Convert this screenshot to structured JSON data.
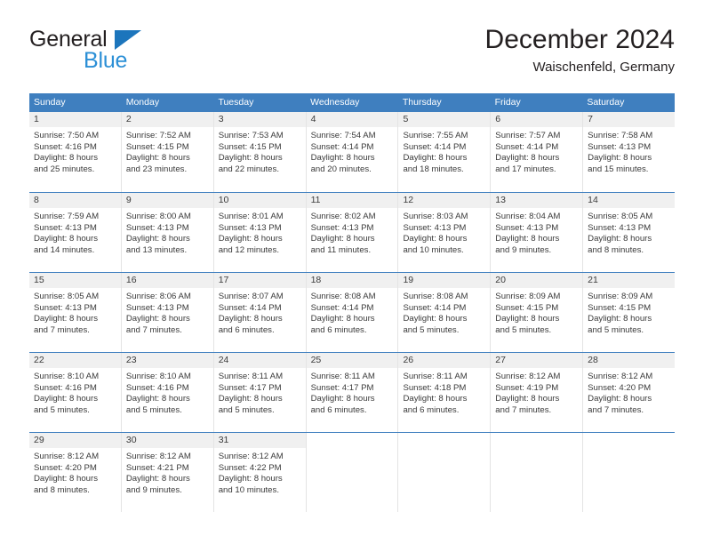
{
  "brand": {
    "name_top": "General",
    "name_bottom": "Blue",
    "triangle_color": "#1c75bc",
    "blue_text_color": "#2b8fd6"
  },
  "header": {
    "title": "December 2024",
    "subtitle": "Waischenfeld, Germany"
  },
  "theme": {
    "header_row_bg": "#3f7fbf",
    "header_row_text": "#ffffff",
    "day_number_bg": "#f0f0f0",
    "row_separator": "#3f7fbf",
    "cell_divider": "#e4e4e4",
    "body_text": "#3a3a3a"
  },
  "weekdays": [
    "Sunday",
    "Monday",
    "Tuesday",
    "Wednesday",
    "Thursday",
    "Friday",
    "Saturday"
  ],
  "weeks": [
    [
      {
        "day": "1",
        "sunrise": "Sunrise: 7:50 AM",
        "sunset": "Sunset: 4:16 PM",
        "daylight1": "Daylight: 8 hours",
        "daylight2": "and 25 minutes."
      },
      {
        "day": "2",
        "sunrise": "Sunrise: 7:52 AM",
        "sunset": "Sunset: 4:15 PM",
        "daylight1": "Daylight: 8 hours",
        "daylight2": "and 23 minutes."
      },
      {
        "day": "3",
        "sunrise": "Sunrise: 7:53 AM",
        "sunset": "Sunset: 4:15 PM",
        "daylight1": "Daylight: 8 hours",
        "daylight2": "and 22 minutes."
      },
      {
        "day": "4",
        "sunrise": "Sunrise: 7:54 AM",
        "sunset": "Sunset: 4:14 PM",
        "daylight1": "Daylight: 8 hours",
        "daylight2": "and 20 minutes."
      },
      {
        "day": "5",
        "sunrise": "Sunrise: 7:55 AM",
        "sunset": "Sunset: 4:14 PM",
        "daylight1": "Daylight: 8 hours",
        "daylight2": "and 18 minutes."
      },
      {
        "day": "6",
        "sunrise": "Sunrise: 7:57 AM",
        "sunset": "Sunset: 4:14 PM",
        "daylight1": "Daylight: 8 hours",
        "daylight2": "and 17 minutes."
      },
      {
        "day": "7",
        "sunrise": "Sunrise: 7:58 AM",
        "sunset": "Sunset: 4:13 PM",
        "daylight1": "Daylight: 8 hours",
        "daylight2": "and 15 minutes."
      }
    ],
    [
      {
        "day": "8",
        "sunrise": "Sunrise: 7:59 AM",
        "sunset": "Sunset: 4:13 PM",
        "daylight1": "Daylight: 8 hours",
        "daylight2": "and 14 minutes."
      },
      {
        "day": "9",
        "sunrise": "Sunrise: 8:00 AM",
        "sunset": "Sunset: 4:13 PM",
        "daylight1": "Daylight: 8 hours",
        "daylight2": "and 13 minutes."
      },
      {
        "day": "10",
        "sunrise": "Sunrise: 8:01 AM",
        "sunset": "Sunset: 4:13 PM",
        "daylight1": "Daylight: 8 hours",
        "daylight2": "and 12 minutes."
      },
      {
        "day": "11",
        "sunrise": "Sunrise: 8:02 AM",
        "sunset": "Sunset: 4:13 PM",
        "daylight1": "Daylight: 8 hours",
        "daylight2": "and 11 minutes."
      },
      {
        "day": "12",
        "sunrise": "Sunrise: 8:03 AM",
        "sunset": "Sunset: 4:13 PM",
        "daylight1": "Daylight: 8 hours",
        "daylight2": "and 10 minutes."
      },
      {
        "day": "13",
        "sunrise": "Sunrise: 8:04 AM",
        "sunset": "Sunset: 4:13 PM",
        "daylight1": "Daylight: 8 hours",
        "daylight2": "and 9 minutes."
      },
      {
        "day": "14",
        "sunrise": "Sunrise: 8:05 AM",
        "sunset": "Sunset: 4:13 PM",
        "daylight1": "Daylight: 8 hours",
        "daylight2": "and 8 minutes."
      }
    ],
    [
      {
        "day": "15",
        "sunrise": "Sunrise: 8:05 AM",
        "sunset": "Sunset: 4:13 PM",
        "daylight1": "Daylight: 8 hours",
        "daylight2": "and 7 minutes."
      },
      {
        "day": "16",
        "sunrise": "Sunrise: 8:06 AM",
        "sunset": "Sunset: 4:13 PM",
        "daylight1": "Daylight: 8 hours",
        "daylight2": "and 7 minutes."
      },
      {
        "day": "17",
        "sunrise": "Sunrise: 8:07 AM",
        "sunset": "Sunset: 4:14 PM",
        "daylight1": "Daylight: 8 hours",
        "daylight2": "and 6 minutes."
      },
      {
        "day": "18",
        "sunrise": "Sunrise: 8:08 AM",
        "sunset": "Sunset: 4:14 PM",
        "daylight1": "Daylight: 8 hours",
        "daylight2": "and 6 minutes."
      },
      {
        "day": "19",
        "sunrise": "Sunrise: 8:08 AM",
        "sunset": "Sunset: 4:14 PM",
        "daylight1": "Daylight: 8 hours",
        "daylight2": "and 5 minutes."
      },
      {
        "day": "20",
        "sunrise": "Sunrise: 8:09 AM",
        "sunset": "Sunset: 4:15 PM",
        "daylight1": "Daylight: 8 hours",
        "daylight2": "and 5 minutes."
      },
      {
        "day": "21",
        "sunrise": "Sunrise: 8:09 AM",
        "sunset": "Sunset: 4:15 PM",
        "daylight1": "Daylight: 8 hours",
        "daylight2": "and 5 minutes."
      }
    ],
    [
      {
        "day": "22",
        "sunrise": "Sunrise: 8:10 AM",
        "sunset": "Sunset: 4:16 PM",
        "daylight1": "Daylight: 8 hours",
        "daylight2": "and 5 minutes."
      },
      {
        "day": "23",
        "sunrise": "Sunrise: 8:10 AM",
        "sunset": "Sunset: 4:16 PM",
        "daylight1": "Daylight: 8 hours",
        "daylight2": "and 5 minutes."
      },
      {
        "day": "24",
        "sunrise": "Sunrise: 8:11 AM",
        "sunset": "Sunset: 4:17 PM",
        "daylight1": "Daylight: 8 hours",
        "daylight2": "and 5 minutes."
      },
      {
        "day": "25",
        "sunrise": "Sunrise: 8:11 AM",
        "sunset": "Sunset: 4:17 PM",
        "daylight1": "Daylight: 8 hours",
        "daylight2": "and 6 minutes."
      },
      {
        "day": "26",
        "sunrise": "Sunrise: 8:11 AM",
        "sunset": "Sunset: 4:18 PM",
        "daylight1": "Daylight: 8 hours",
        "daylight2": "and 6 minutes."
      },
      {
        "day": "27",
        "sunrise": "Sunrise: 8:12 AM",
        "sunset": "Sunset: 4:19 PM",
        "daylight1": "Daylight: 8 hours",
        "daylight2": "and 7 minutes."
      },
      {
        "day": "28",
        "sunrise": "Sunrise: 8:12 AM",
        "sunset": "Sunset: 4:20 PM",
        "daylight1": "Daylight: 8 hours",
        "daylight2": "and 7 minutes."
      }
    ],
    [
      {
        "day": "29",
        "sunrise": "Sunrise: 8:12 AM",
        "sunset": "Sunset: 4:20 PM",
        "daylight1": "Daylight: 8 hours",
        "daylight2": "and 8 minutes."
      },
      {
        "day": "30",
        "sunrise": "Sunrise: 8:12 AM",
        "sunset": "Sunset: 4:21 PM",
        "daylight1": "Daylight: 8 hours",
        "daylight2": "and 9 minutes."
      },
      {
        "day": "31",
        "sunrise": "Sunrise: 8:12 AM",
        "sunset": "Sunset: 4:22 PM",
        "daylight1": "Daylight: 8 hours",
        "daylight2": "and 10 minutes."
      },
      {
        "day": "",
        "sunrise": "",
        "sunset": "",
        "daylight1": "",
        "daylight2": ""
      },
      {
        "day": "",
        "sunrise": "",
        "sunset": "",
        "daylight1": "",
        "daylight2": ""
      },
      {
        "day": "",
        "sunrise": "",
        "sunset": "",
        "daylight1": "",
        "daylight2": ""
      },
      {
        "day": "",
        "sunrise": "",
        "sunset": "",
        "daylight1": "",
        "daylight2": ""
      }
    ]
  ]
}
